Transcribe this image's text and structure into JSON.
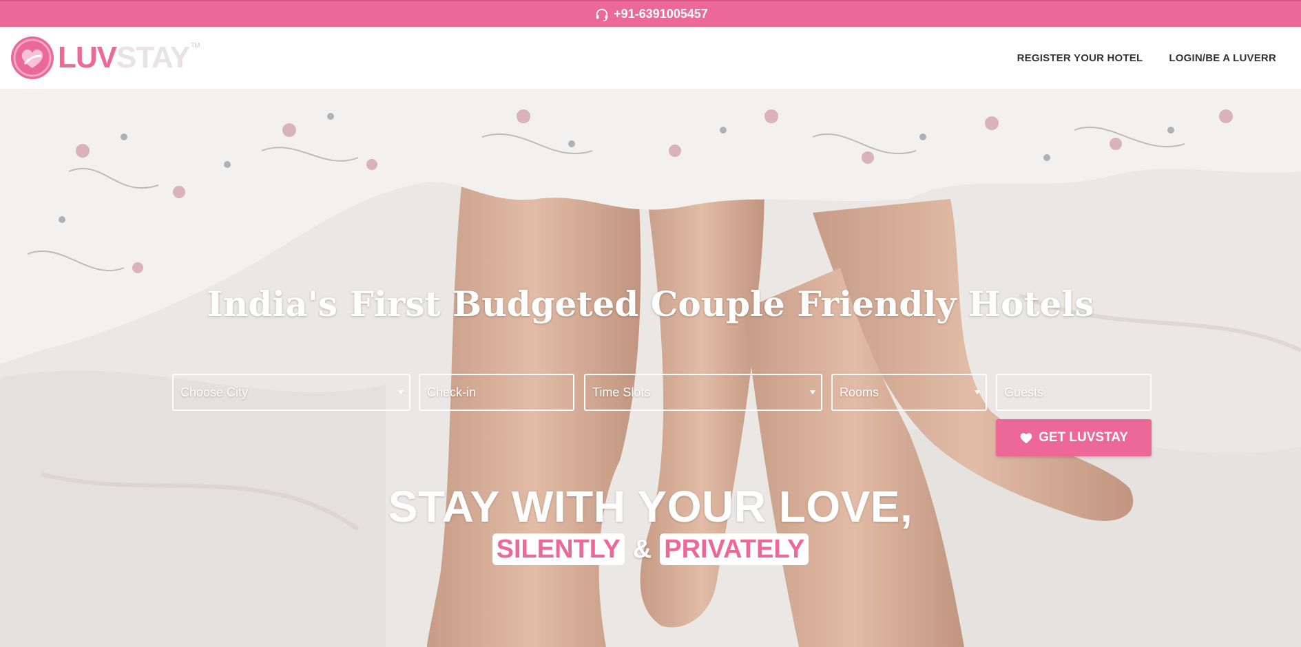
{
  "topbar": {
    "phone": "+91-6391005457",
    "icon": "headset-icon",
    "color": "#ec6896"
  },
  "header": {
    "logo": {
      "part1": "LUV",
      "part2": "STAY",
      "tm": "TM"
    },
    "nav": {
      "register": "REGISTER YOUR HOTEL",
      "login": "LOGIN/BE A LUVERR"
    }
  },
  "hero": {
    "title": "India's First Budgeted Couple Friendly Hotels",
    "search": {
      "city_placeholder": "Choose City",
      "checkin_placeholder": "Check-in",
      "timeslot_placeholder": "Time Slots",
      "rooms_placeholder": "Rooms",
      "guests_placeholder": "Guests",
      "submit_label": "GET LUVSTAY"
    },
    "slogan_line1": "STAY WITH YOUR LOVE,",
    "slogan_word1": "SILENTLY",
    "slogan_amp": "&",
    "slogan_word2": "PRIVATELY"
  },
  "colors": {
    "accent": "#ec6896",
    "text_dark": "#333333",
    "white": "#ffffff"
  }
}
